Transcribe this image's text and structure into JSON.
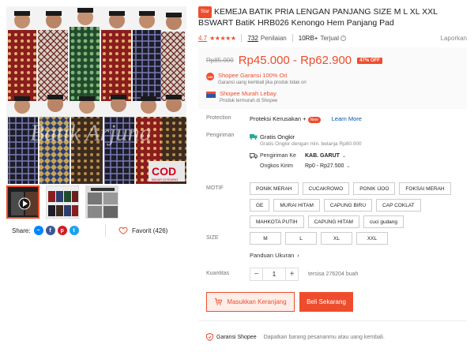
{
  "gallery": {
    "main_watermark": "Batik Arjuna",
    "cod_badge": "COD",
    "cod_sub": "BAYAR DITEMPAT",
    "share_label": "Share:",
    "favorite_label": "Favorit (426)"
  },
  "product": {
    "star_badge": "Star",
    "title": "KEMEJA BATIK PRIA LENGAN PANJANG SIZE M L XL XXL BSWART BatiK HRB026 Kenongo Hem Panjang Pad",
    "rating": "4.7",
    "stars": "★★★★★",
    "ratings_count": "732",
    "ratings_label": "Penilaian",
    "sold_count": "10RB+",
    "sold_label": "Terjual",
    "report": "Laporkan"
  },
  "price": {
    "original": "Rp85.000",
    "current": "Rp45.000 - Rp62.900",
    "discount": "47% OFF",
    "guarantee_title": "Shopee Garansi 100% Ori",
    "guarantee_sub": "Garansi uang kembali jika produk tidak ori",
    "murah_title": "Shopee Murah Lebay",
    "murah_sub": "Produk termurah di Shopee"
  },
  "protection": {
    "label": "Protection",
    "value": "Proteksi Kerusakan +",
    "new_badge": "New",
    "learn_more": "Learn More"
  },
  "shipping": {
    "label": "Pengiriman",
    "free_title": "Gratis Ongkir",
    "free_sub": "Gratis Ongkir dengan min. belanja Rp80.000",
    "to_label": "Pengiriman Ke",
    "to_value": "KAB. GARUT",
    "cost_label": "Ongkos Kirim",
    "cost_value": "Rp0 - Rp27.500"
  },
  "motif": {
    "label": "MOTIF",
    "options": [
      "PONIK MERAH",
      "CUCAKROWO",
      "PONIK IJOO",
      "FOKSAI MERAH",
      "GE",
      "MURAI HITAM",
      "CAPUNG BIRU",
      "CAP COKLAT",
      "MAHKOTA PUTIH",
      "CAPUNG HITAM",
      "cuci gudang"
    ]
  },
  "size": {
    "label": "SIZE",
    "options": [
      "M",
      "L",
      "XL",
      "XXL"
    ],
    "guide": "Panduan Ukuran"
  },
  "quantity": {
    "label": "Kuantitas",
    "minus": "−",
    "value": "1",
    "plus": "+",
    "stock": "tersisa 276204 buah"
  },
  "actions": {
    "add_to_cart": "Masukkan Keranjang",
    "buy_now": "Beli Sekarang"
  },
  "footer": {
    "guarantee_title": "Garansi Shopee",
    "guarantee_sub": "Dapatkan barang pesananmu atau uang kembali."
  },
  "colors": {
    "accent": "#ee4d2d",
    "link": "#0055aa"
  }
}
